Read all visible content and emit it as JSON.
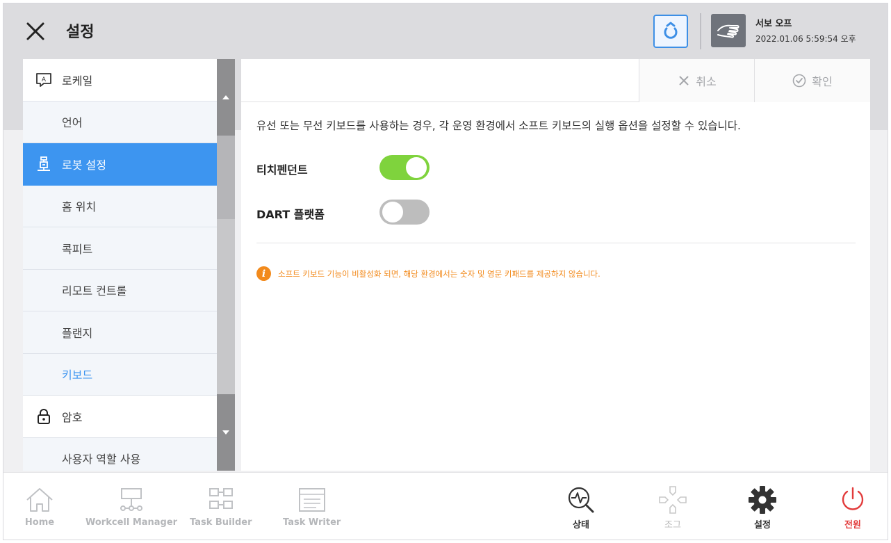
{
  "header": {
    "title": "설정",
    "servo_status": "서보 오프",
    "datetime": "2022.01.06 5:59:54 오후"
  },
  "sidebar": {
    "items": [
      {
        "label": "로케일",
        "type": "category",
        "icon": "locale-icon"
      },
      {
        "label": "언어",
        "type": "sub"
      },
      {
        "label": "로봇 설정",
        "type": "category",
        "icon": "robot-icon",
        "active": true
      },
      {
        "label": "홈 위치",
        "type": "sub"
      },
      {
        "label": "콕피트",
        "type": "sub"
      },
      {
        "label": "리모트 컨트롤",
        "type": "sub"
      },
      {
        "label": "플랜지",
        "type": "sub"
      },
      {
        "label": "키보드",
        "type": "sub",
        "current": true
      },
      {
        "label": "암호",
        "type": "category",
        "icon": "lock-icon"
      },
      {
        "label": "사용자 역할 사용",
        "type": "sub"
      }
    ]
  },
  "toolbar": {
    "cancel_label": "취소",
    "confirm_label": "확인"
  },
  "content": {
    "description": "유선 또는 무선 키보드를 사용하는 경우, 각 운영 환경에서 소프트 키보드의 실행 옵션을 설정할 수 있습니다.",
    "options": [
      {
        "label": "티치펜던트",
        "enabled": true
      },
      {
        "label": "DART 플랫폼",
        "enabled": false
      }
    ],
    "notice": "소프트 키보드 기능이 비활성화 되면, 해당 환경에서는 숫자 및 영문 키패드를 제공하지 않습니다."
  },
  "bottom_nav": {
    "home": "Home",
    "workcell_manager": "Workcell Manager",
    "task_builder": "Task Builder",
    "task_writer": "Task Writer",
    "status": "상태",
    "jog": "조그",
    "settings": "설정",
    "power": "전원"
  },
  "colors": {
    "accent": "#3d95f0",
    "toggle_on": "#7fd33d",
    "toggle_off": "#bdbdbd",
    "notice": "#f28a1c",
    "power": "#e23b3b"
  }
}
